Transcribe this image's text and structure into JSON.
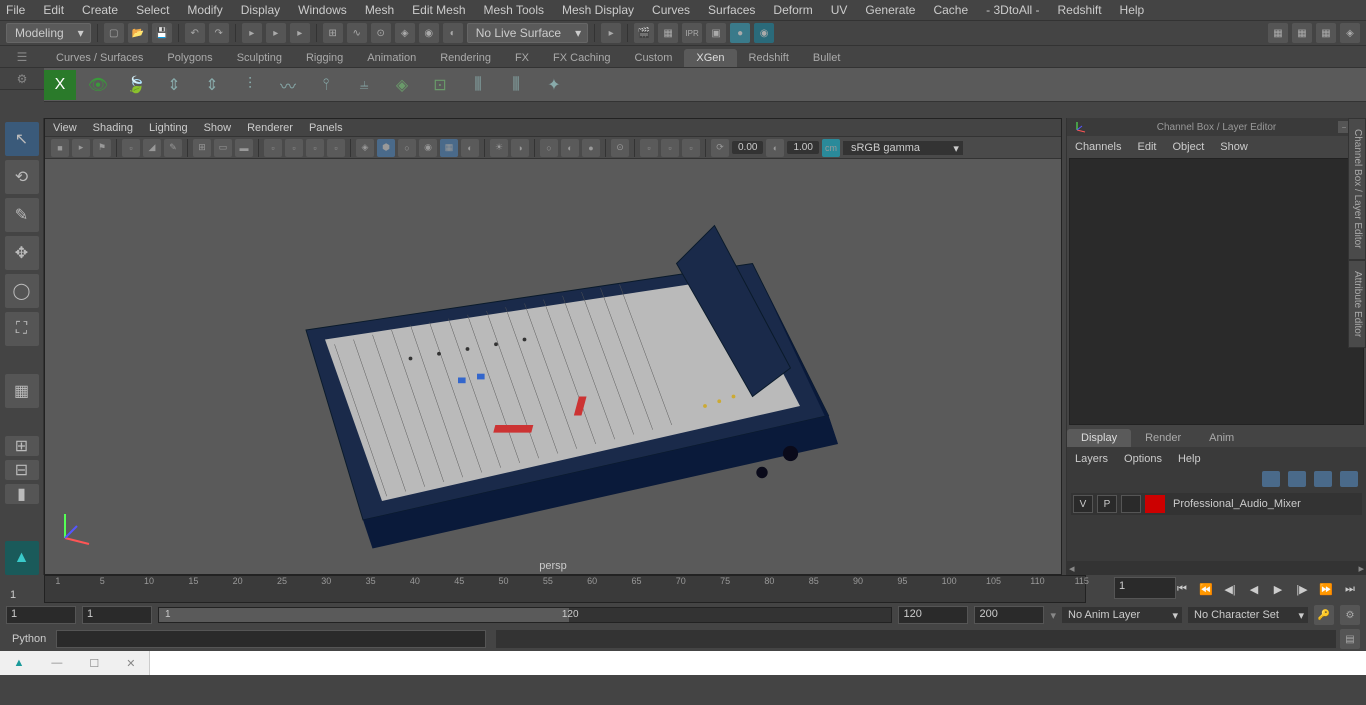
{
  "menubar": [
    "File",
    "Edit",
    "Create",
    "Select",
    "Modify",
    "Display",
    "Windows",
    "Mesh",
    "Edit Mesh",
    "Mesh Tools",
    "Mesh Display",
    "Curves",
    "Surfaces",
    "Deform",
    "UV",
    "Generate",
    "Cache",
    "- 3DtoAll -",
    "Redshift",
    "Help"
  ],
  "workspace_dropdown": "Modeling",
  "status_dropdown": "No Live Surface",
  "shelves": [
    "Curves / Surfaces",
    "Polygons",
    "Sculpting",
    "Rigging",
    "Animation",
    "Rendering",
    "FX",
    "FX Caching",
    "Custom",
    "XGen",
    "Redshift",
    "Bullet"
  ],
  "active_shelf": "XGen",
  "viewport": {
    "menus": [
      "View",
      "Shading",
      "Lighting",
      "Show",
      "Renderer",
      "Panels"
    ],
    "val1": "0.00",
    "val2": "1.00",
    "colorspace": "sRGB gamma",
    "camera": "persp"
  },
  "channelbox": {
    "title": "Channel Box / Layer Editor",
    "tabs": [
      "Channels",
      "Edit",
      "Object",
      "Show"
    ],
    "btabs": [
      "Display",
      "Render",
      "Anim"
    ],
    "layer_menus": [
      "Layers",
      "Options",
      "Help"
    ],
    "layer": {
      "V": "V",
      "P": "P",
      "name": "Professional_Audio_Mixer"
    }
  },
  "side_tabs": [
    "Channel Box / Layer Editor",
    "Attribute Editor"
  ],
  "timeline": {
    "start": "1",
    "startR": "1",
    "end": "120",
    "endR": "200",
    "frame": "1",
    "anim_layer": "No Anim Layer",
    "char_set": "No Character Set",
    "ticks": [
      1,
      5,
      10,
      15,
      20,
      25,
      30,
      35,
      40,
      45,
      50,
      55,
      60,
      65,
      70,
      75,
      80,
      85,
      90,
      95,
      100,
      105,
      110,
      115
    ]
  },
  "cmd": {
    "lang": "Python"
  }
}
